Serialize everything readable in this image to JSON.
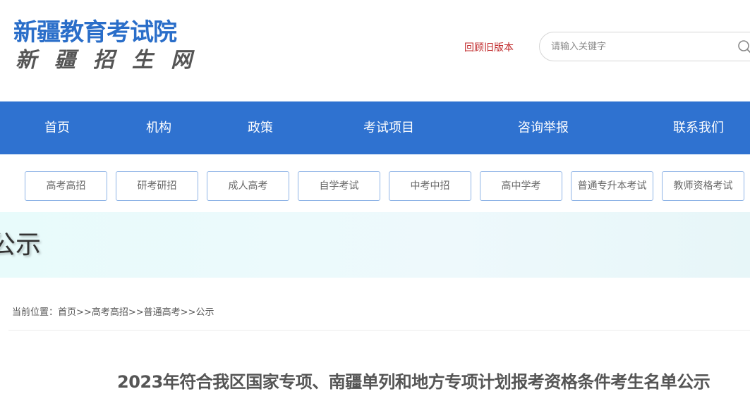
{
  "header": {
    "logo_main": "新疆教育考试院",
    "logo_sub": "新疆招生网",
    "old_version_link": "回顾旧版本",
    "search": {
      "placeholder": "请输入关键字",
      "icon": "search-icon"
    }
  },
  "nav": {
    "items": [
      {
        "label": "首页"
      },
      {
        "label": "机构"
      },
      {
        "label": "政策"
      },
      {
        "label": "考试项目"
      },
      {
        "label": "咨询举报"
      },
      {
        "label": "联系我们"
      }
    ]
  },
  "sub_nav": {
    "items": [
      {
        "label": "高考高招"
      },
      {
        "label": "研考研招"
      },
      {
        "label": "成人高考"
      },
      {
        "label": "自学考试"
      },
      {
        "label": "中考中招"
      },
      {
        "label": "高中学考"
      },
      {
        "label": "普通专升本考试"
      },
      {
        "label": "教师资格考试"
      }
    ]
  },
  "banner": {
    "title": "公示"
  },
  "breadcrumb": {
    "prefix": "当前位置：",
    "items": [
      "首页",
      "高考高招",
      "普通高考",
      "公示"
    ],
    "separator": ">>"
  },
  "article": {
    "title": "2023年符合我区国家专项、南疆单列和地方专项计划报考资格条件考生名单公示"
  },
  "colors": {
    "brand_blue": "#2f72d0",
    "logo_blue": "#2a6ec9",
    "link_red": "#c0282a",
    "banner_bg": "#eaf9fb"
  }
}
